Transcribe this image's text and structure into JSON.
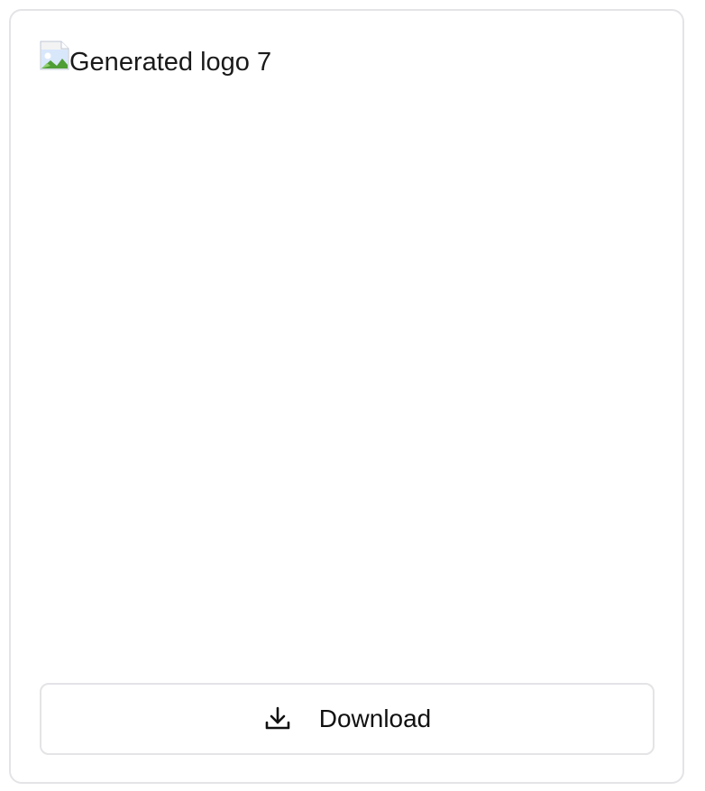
{
  "logo_card": {
    "image_alt": "Generated logo 7",
    "broken_image_icon": "broken-image-icon",
    "download_icon": "download-icon",
    "download_label": "Download"
  },
  "colors": {
    "border": "#e4e4e7",
    "text": "#111111"
  }
}
